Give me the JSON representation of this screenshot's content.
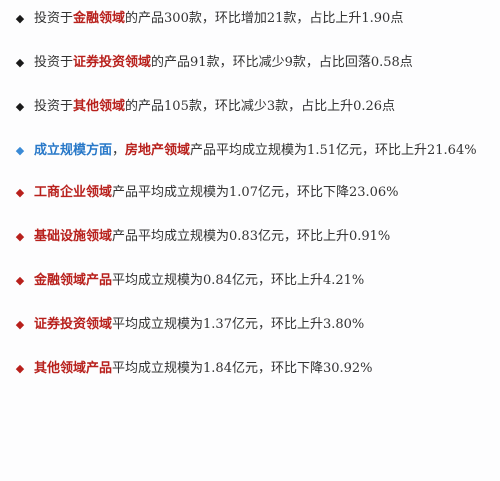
{
  "colors": {
    "bullet_black": "#1a1a1a",
    "bullet_blue": "#3a8ad6",
    "bullet_red": "#b8201c",
    "highlight_red": "#b8201c",
    "highlight_blue": "#2878c8",
    "text": "#333333"
  },
  "items": [
    {
      "bullet_icon": "black-diamond-icon",
      "prefix": "投资于",
      "highlight": "金融领域",
      "text": "的产品300款，环比增加21款，占比上升1.90点"
    },
    {
      "bullet_icon": "black-diamond-icon",
      "prefix": "投资于",
      "highlight": "证券投资领域",
      "text": "的产品91款，环比减少9款，占比回落0.58点"
    },
    {
      "bullet_icon": "black-diamond-icon",
      "prefix": "投资于",
      "highlight": "其他领域",
      "text": "的产品105款，环比减少3款，占比上升0.26点"
    },
    {
      "bullet_icon": "blue-diamond-icon",
      "highlight_blue": "成立规模方面",
      "separator": "，",
      "highlight": "房地产领域",
      "text": "产品平均成立规模为1.51亿元，环比上升21.64%"
    },
    {
      "bullet_icon": "red-diamond-icon",
      "highlight": "工商企业领域",
      "text": "产品平均成立规模为1.07亿元，环比下降23.06%"
    },
    {
      "bullet_icon": "red-diamond-icon",
      "highlight": "基础设施领域",
      "text": "产品平均成立规模为0.83亿元，环比上升0.91%"
    },
    {
      "bullet_icon": "red-diamond-icon",
      "highlight": "金融领域产品",
      "text": "平均成立规模为0.84亿元，环比上升4.21%"
    },
    {
      "bullet_icon": "red-diamond-icon",
      "highlight": "证券投资领域",
      "text": "平均成立规模为1.37亿元，环比上升3.80%"
    },
    {
      "bullet_icon": "red-diamond-icon",
      "highlight": "其他领域产品",
      "text": "平均成立规模为1.84亿元，环比下降30.92%"
    }
  ]
}
